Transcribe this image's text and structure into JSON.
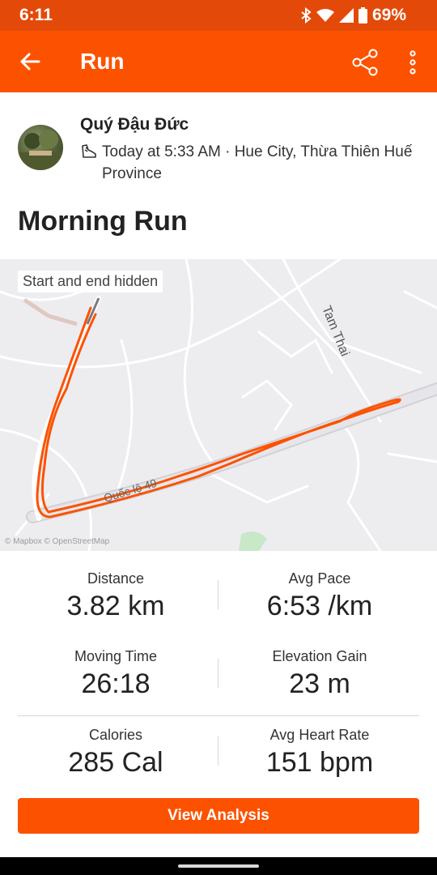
{
  "status_bar": {
    "time": "6:11",
    "battery": "69%"
  },
  "app_bar": {
    "title": "Run"
  },
  "activity": {
    "athlete_name": "Quý Đậu Đức",
    "meta_text": "Today at 5:33 AM · Hue City, Thừa Thiên Huế Province",
    "title": "Morning Run"
  },
  "map": {
    "privacy_badge": "Start and end hidden",
    "street_label_1": "Tam Thai",
    "street_label_2": "Quốc lộ 49",
    "attribution": "© Mapbox © OpenStreetMap"
  },
  "stats": [
    {
      "label": "Distance",
      "value": "3.82 km"
    },
    {
      "label": "Avg Pace",
      "value": "6:53 /km"
    },
    {
      "label": "Moving Time",
      "value": "26:18"
    },
    {
      "label": "Elevation Gain",
      "value": "23 m"
    },
    {
      "label": "Calories",
      "value": "285 Cal"
    },
    {
      "label": "Avg Heart Rate",
      "value": "151 bpm"
    }
  ],
  "cta": {
    "label": "View Analysis"
  },
  "colors": {
    "brand": "#fc5200",
    "status_bar": "#e34a0a",
    "route": "#fc5200"
  }
}
